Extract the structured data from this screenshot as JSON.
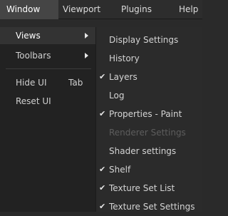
{
  "menubar": {
    "items": [
      "Window",
      "Viewport",
      "Plugins",
      "Help"
    ]
  },
  "window_menu": {
    "items": [
      {
        "label": "Views"
      },
      {
        "label": "Toolbars"
      },
      {
        "label": "Hide UI",
        "shortcut": "Tab"
      },
      {
        "label": "Reset UI"
      }
    ]
  },
  "views_submenu": {
    "items": [
      {
        "label": "Display Settings",
        "checked": false,
        "enabled": true
      },
      {
        "label": "History",
        "checked": false,
        "enabled": true
      },
      {
        "label": "Layers",
        "checked": true,
        "enabled": true
      },
      {
        "label": "Log",
        "checked": false,
        "enabled": true
      },
      {
        "label": "Properties - Paint",
        "checked": true,
        "enabled": true
      },
      {
        "label": "Renderer Settings",
        "checked": false,
        "enabled": false
      },
      {
        "label": "Shader settings",
        "checked": false,
        "enabled": true
      },
      {
        "label": "Shelf",
        "checked": true,
        "enabled": true
      },
      {
        "label": "Texture Set List",
        "checked": true,
        "enabled": true
      },
      {
        "label": "Texture Set Settings",
        "checked": true,
        "enabled": true
      }
    ],
    "check_glyph": "✔"
  }
}
